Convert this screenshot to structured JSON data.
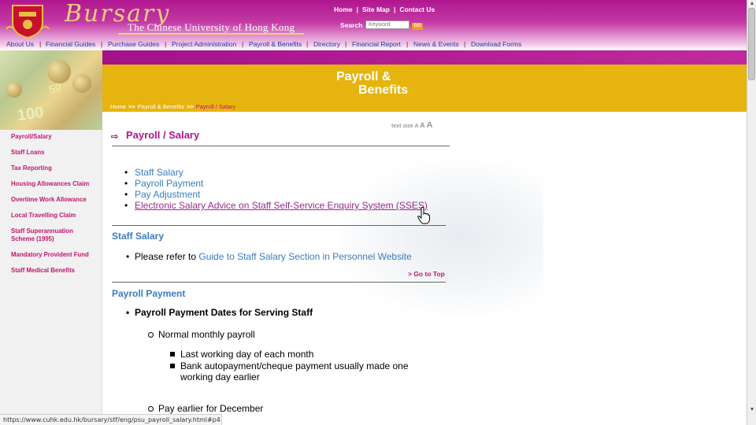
{
  "header": {
    "logo_script": "Bursary",
    "university_name": "The Chinese University of Hong Kong",
    "top_links": [
      "Home",
      "Site Map",
      "Contact Us"
    ],
    "search_label": "Search",
    "search_placeholder": "Keyword",
    "go_label": "GO"
  },
  "main_nav": [
    "About Us",
    "Financial Guides",
    "Purchase Guides",
    "Project Administration",
    "Payroll & Benefits",
    "Directory",
    "Financial Report",
    "News & Events",
    "Download Forms"
  ],
  "banner": {
    "title_line1": "Payroll &",
    "title_line2": "Benefits"
  },
  "breadcrumb": {
    "items": [
      "Home",
      "Payroll & Benefits",
      "Payroll / Salary"
    ],
    "separator": ">>"
  },
  "sidebar": {
    "items": [
      "Payroll/Salary",
      "Staff Loans",
      "Tax Reporting",
      "Housing Allowances Claim",
      "Overtime Work Allowance",
      "Local Travelling Claim",
      "Staff Superannuation Scheme (1995)",
      "Mandatory Provident Fund",
      "Staff Medical Benefits"
    ]
  },
  "content": {
    "text_size_label": "text size",
    "text_size_options": [
      "A",
      "A",
      "A"
    ],
    "page_title": "Payroll / Salary",
    "toc": [
      "Staff Salary",
      "Payroll Payment",
      "Pay Adjustment",
      "Electronic Salary Advice on Staff Self-Service Enquiry System (SSES)"
    ],
    "staff_salary": {
      "heading": "Staff Salary",
      "text_prefix": "Please refer to ",
      "link": "Guide to Staff Salary Section in Personnel Website"
    },
    "go_to_top": "> Go to Top",
    "payroll_payment": {
      "heading": "Payroll Payment",
      "bold_item": "Payroll Payment Dates for Serving Staff",
      "sub1": "Normal monthly payroll",
      "sub1_items": [
        "Last working day of each month",
        "Bank autopayment/cheque payment usually made one working day earlier"
      ],
      "sub2": "Pay earlier for December"
    }
  },
  "status_bar": {
    "url": "https://www.cuhk.edu.hk/bursary/stf/eng/psu_payroll_salary.html#p4"
  },
  "colors": {
    "magenta": "#b0168f",
    "gold": "#e6b40e",
    "link_blue": "#3a7dbf",
    "nav_blue": "#1a3fa6",
    "sidebar_pink": "#c0166f"
  }
}
